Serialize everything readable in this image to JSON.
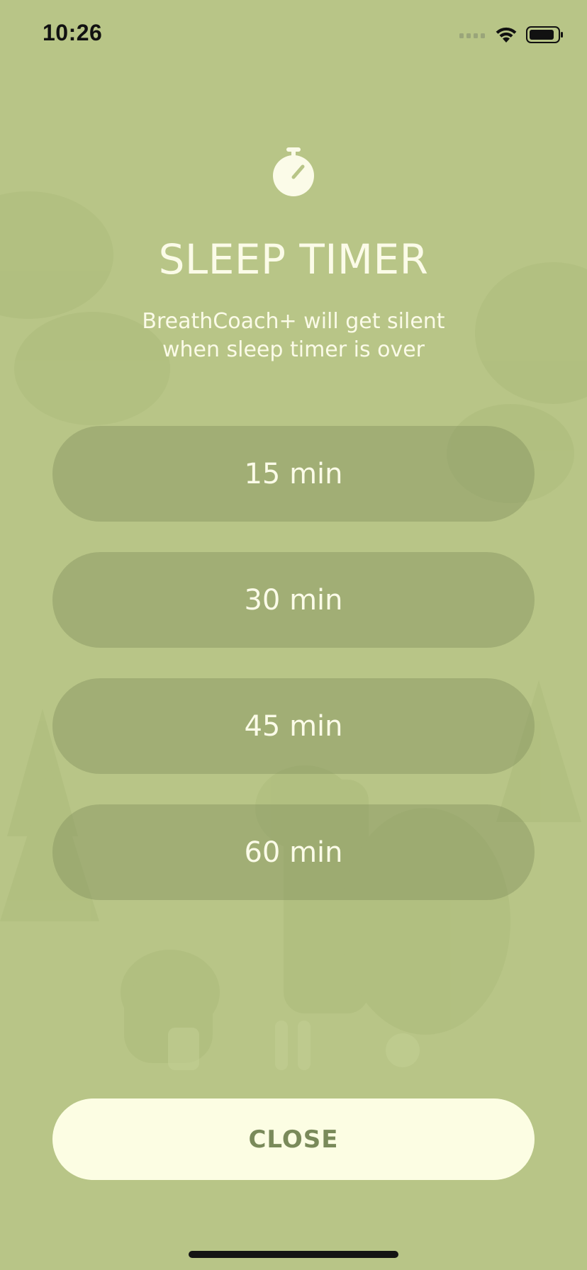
{
  "status_bar": {
    "time": "10:26"
  },
  "header": {
    "icon": "stopwatch-icon",
    "title": "SLEEP TIMER",
    "subtitle_line1": "BreathCoach+ will get silent",
    "subtitle_line2": "when sleep timer is over"
  },
  "options": [
    {
      "label": "15 min"
    },
    {
      "label": "30 min"
    },
    {
      "label": "45 min"
    },
    {
      "label": "60 min"
    }
  ],
  "close_label": "CLOSE",
  "colors": {
    "background": "#b8c587",
    "option_fill": "#a3b077",
    "close_fill": "#fcfde3",
    "close_text": "#7a8a5a",
    "text": "#fbfbe8"
  }
}
